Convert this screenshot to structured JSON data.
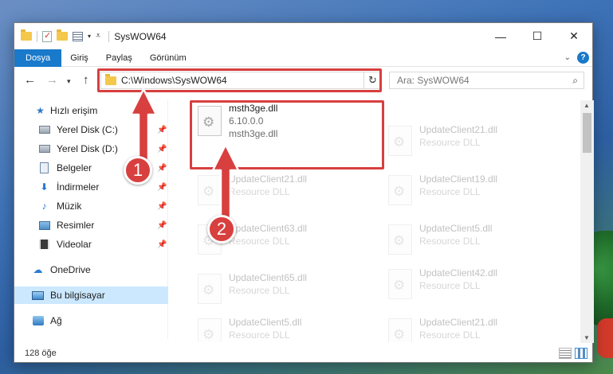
{
  "window": {
    "title": "SysWOW64",
    "controls": {
      "minimize": "—",
      "maximize": "☐",
      "close": "✕"
    }
  },
  "ribbon": {
    "tabs": [
      "Dosya",
      "Giriş",
      "Paylaş",
      "Görünüm"
    ],
    "active_tab": "Dosya",
    "accent_color": "#1979ca"
  },
  "navigation": {
    "address": "C:\\Windows\\SysWOW64",
    "search_placeholder": "Ara: SysWOW64"
  },
  "sidebar": {
    "items": [
      {
        "label": "Hızlı erişim",
        "icon": "star-icon",
        "pinned": false
      },
      {
        "label": "Yerel Disk (C:)",
        "icon": "drive-icon",
        "pinned": true
      },
      {
        "label": "Yerel Disk (D:)",
        "icon": "drive-icon",
        "pinned": true
      },
      {
        "label": "Belgeler",
        "icon": "documents-icon",
        "pinned": true
      },
      {
        "label": "İndirmeler",
        "icon": "downloads-icon",
        "pinned": true
      },
      {
        "label": "Müzik",
        "icon": "music-icon",
        "pinned": true
      },
      {
        "label": "Resimler",
        "icon": "pictures-icon",
        "pinned": true
      },
      {
        "label": "Videolar",
        "icon": "videos-icon",
        "pinned": true
      },
      {
        "label": "OneDrive",
        "icon": "onedrive-icon",
        "pinned": false
      },
      {
        "label": "Bu bilgisayar",
        "icon": "this-pc-icon",
        "pinned": false,
        "selected": true
      },
      {
        "label": "Ağ",
        "icon": "network-icon",
        "pinned": false
      }
    ]
  },
  "files": {
    "highlighted": {
      "name": "msth3ge.dll",
      "version": "6.10.0.0",
      "description": "msth3ge.dll"
    },
    "left_column": [
      {
        "name": "UpdateClient21.dll",
        "description": "Resource DLL"
      },
      {
        "name": "UpdateClient63.dll",
        "description": "Resource DLL"
      },
      {
        "name": "UpdateClient65.dll",
        "description": "Resource DLL"
      },
      {
        "name": "UpdateClient5.dll",
        "description": "Resource DLL"
      }
    ],
    "right_column": [
      {
        "name": "UpdateClient21.dll",
        "description": "Resource DLL"
      },
      {
        "name": "UpdateClient19.dll",
        "description": "Resource DLL"
      },
      {
        "name": "UpdateClient5.dll",
        "description": "Resource DLL"
      },
      {
        "name": "UpdateClient42.dll",
        "description": "Resource DLL"
      },
      {
        "name": "UpdateClient21.dll",
        "description": "Resource DLL"
      }
    ]
  },
  "status": {
    "item_count": "128 öğe"
  },
  "callouts": {
    "badge1": "1",
    "badge2": "2",
    "color": "#d83f3f"
  }
}
